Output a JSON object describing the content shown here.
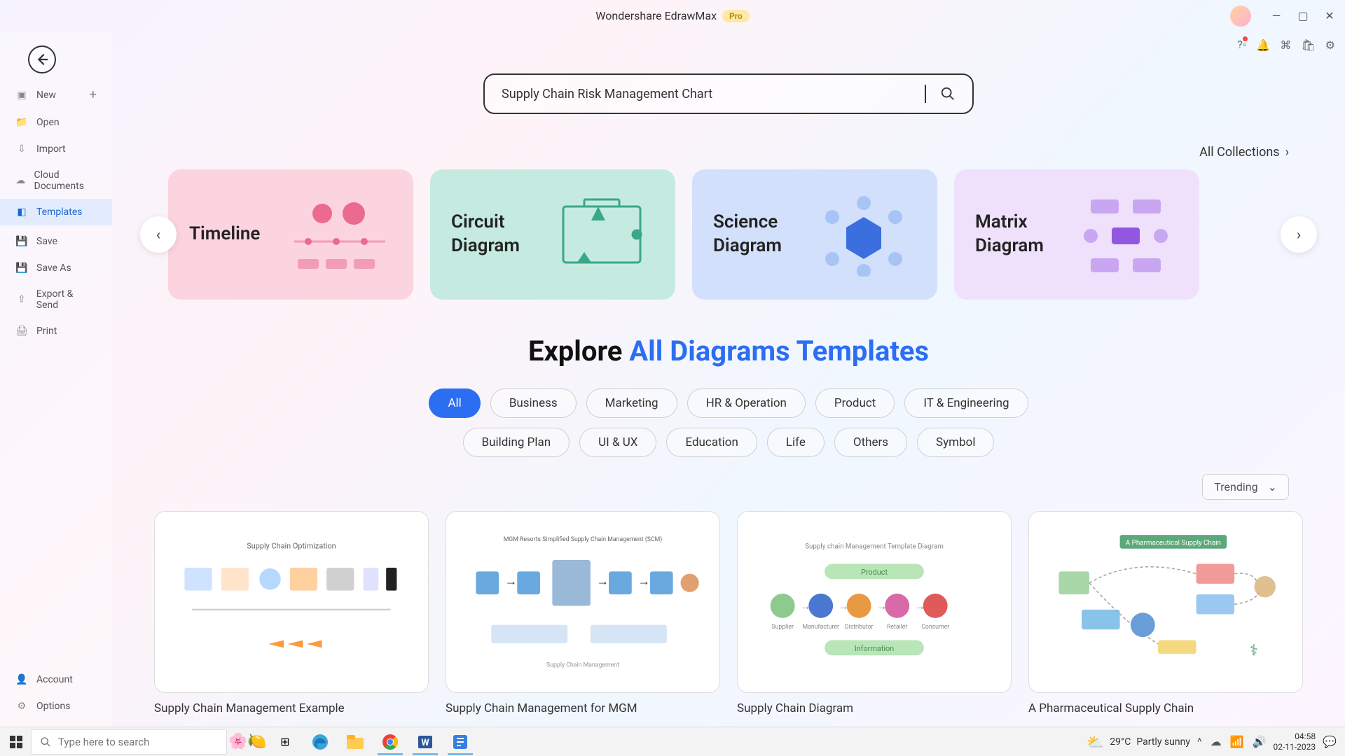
{
  "titlebar": {
    "app": "Wondershare EdrawMax",
    "badge": "Pro"
  },
  "sidebar": {
    "items": [
      {
        "label": "New",
        "icon": "plus-square"
      },
      {
        "label": "Open",
        "icon": "folder"
      },
      {
        "label": "Import",
        "icon": "import"
      },
      {
        "label": "Cloud Documents",
        "icon": "cloud"
      },
      {
        "label": "Templates",
        "icon": "template",
        "active": true
      },
      {
        "label": "Save",
        "icon": "save"
      },
      {
        "label": "Save As",
        "icon": "save-as"
      },
      {
        "label": "Export & Send",
        "icon": "export"
      },
      {
        "label": "Print",
        "icon": "print"
      }
    ],
    "bottom": [
      {
        "label": "Account",
        "icon": "user"
      },
      {
        "label": "Options",
        "icon": "gear"
      }
    ]
  },
  "search": {
    "value": "Supply Chain Risk Management Chart"
  },
  "all_collections_label": "All Collections",
  "collections": [
    {
      "title": "Timeline",
      "color": "pink"
    },
    {
      "title": "Circuit\nDiagram",
      "color": "green"
    },
    {
      "title": "Science\nDiagram",
      "color": "blue"
    },
    {
      "title": "Matrix\nDiagram",
      "color": "purple"
    }
  ],
  "explore": {
    "prefix": "Explore ",
    "accent": "All Diagrams Templates"
  },
  "categories": [
    "All",
    "Business",
    "Marketing",
    "HR & Operation",
    "Product",
    "IT & Engineering",
    "Building Plan",
    "UI & UX",
    "Education",
    "Life",
    "Others",
    "Symbol"
  ],
  "active_category": "All",
  "sort": {
    "label": "Trending"
  },
  "templates": [
    {
      "title": "Supply Chain Management Example"
    },
    {
      "title": "Supply Chain Management for MGM"
    },
    {
      "title": "Supply Chain Diagram"
    },
    {
      "title": "A Pharmaceutical Supply Chain"
    }
  ],
  "taskbar": {
    "search_placeholder": "Type here to search",
    "weather": {
      "temp": "29°C",
      "desc": "Partly sunny"
    },
    "clock": {
      "time": "04:58",
      "date": "02-11-2023"
    }
  }
}
